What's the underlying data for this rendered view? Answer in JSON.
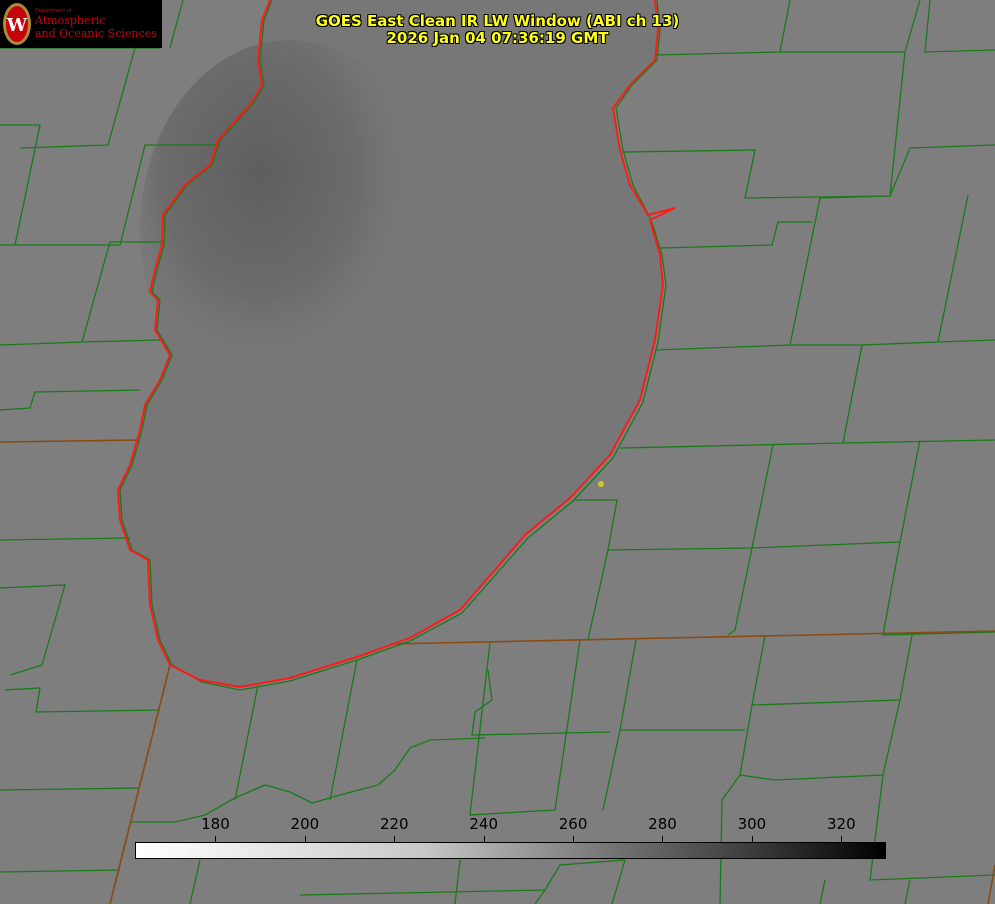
{
  "title": {
    "line1": "GOES East Clean IR LW Window (ABI ch 13)",
    "line2": "2026 Jan 04 07:36:19 GMT"
  },
  "logo": {
    "department": "Department of",
    "line1": "Atmospheric",
    "line2": "and Oceanic Sciences",
    "emblem_letter": "W"
  },
  "colorbar": {
    "units_min": 162,
    "units_max": 330,
    "ticks": [
      "180",
      "200",
      "220",
      "240",
      "260",
      "280",
      "300",
      "320"
    ],
    "tick_values": [
      180,
      200,
      220,
      240,
      260,
      280,
      300,
      320
    ]
  },
  "colors": {
    "coastline": "#ff1a1a",
    "county_lines": "#1a7a1a",
    "state_lines": "#8a4a10",
    "title_text": "#ffff1a",
    "marker": "#d4c81a"
  }
}
